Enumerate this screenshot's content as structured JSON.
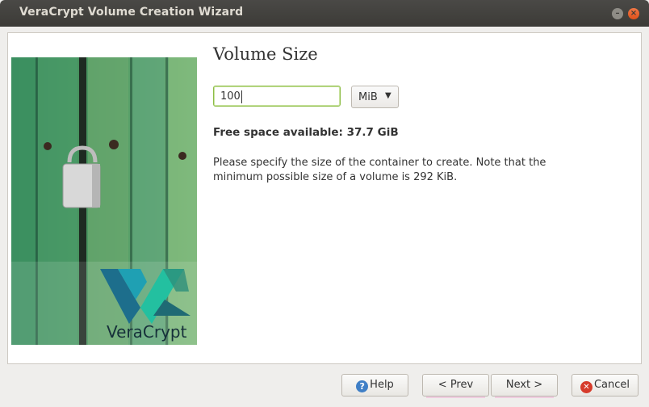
{
  "window": {
    "title": "VeraCrypt Volume Creation Wizard",
    "minimize_glyph": "–",
    "close_glyph": "×"
  },
  "logo": {
    "text": "VeraCrypt"
  },
  "page": {
    "heading": "Volume Size",
    "size_value": "100",
    "unit_selected": "MiB",
    "free_space": "Free space available: 37.7 GiB",
    "description": "Please specify the size of the container to create. Note that the minimum possible size of a volume is 292 KiB."
  },
  "buttons": {
    "help": "Help",
    "prev": "< Prev",
    "next": "Next >",
    "cancel": "Cancel"
  },
  "colors": {
    "titlebar": "#3c3b37",
    "input_focus": "#8dbd46",
    "close_button": "#e0511a"
  }
}
